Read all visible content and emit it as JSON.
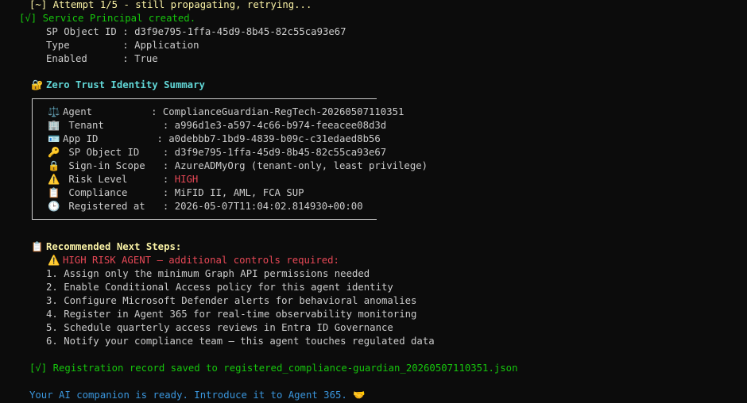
{
  "attempt": "[~] Attempt 1/5 - still propagating, retrying...",
  "sp_created": "[√] Service Principal created.",
  "sp_details": [
    {
      "label": "SP Object ID",
      "value": "d3f9e795-1ffa-45d9-8b45-82c55ca93e67"
    },
    {
      "label": "Type",
      "value": "Application"
    },
    {
      "label": "Enabled",
      "value": "True"
    }
  ],
  "summary": {
    "icon": "🔐",
    "title": "Zero Trust Identity Summary",
    "rows": [
      {
        "icon": "⚖️",
        "label": "Agent",
        "value": "ComplianceGuardian-RegTech-20260507110351"
      },
      {
        "icon": "🏢",
        "label": "Tenant",
        "value": "a996d1e3-a597-4c66-b974-feeacee08d3d"
      },
      {
        "icon": "🪪",
        "label": "App ID",
        "value": "a0debbb7-1bd9-4839-b09c-c31edaed8b56"
      },
      {
        "icon": "🔑",
        "label": "SP Object ID",
        "value": "d3f9e795-1ffa-45d9-8b45-82c55ca93e67"
      },
      {
        "icon": "🔒",
        "label": "Sign-in Scope",
        "value": "AzureADMyOrg (tenant-only, least privilege)"
      },
      {
        "icon": "⚠️",
        "label": "Risk Level",
        "value": "HIGH"
      },
      {
        "icon": "📋",
        "label": "Compliance",
        "value": "MiFID II, AML, FCA SUP"
      },
      {
        "icon": "🕒",
        "label": "Registered at",
        "value": "2026-05-07T11:04:02.814930+00:00"
      }
    ]
  },
  "next_steps": {
    "icon": "📋",
    "title": "Recommended Next Steps:",
    "warning_icon": "⚠️",
    "warning": "HIGH RISK AGENT — additional controls required:",
    "items": [
      "1. Assign only the minimum Graph API permissions needed",
      "2. Enable Conditional Access policy for this agent identity",
      "3. Configure Microsoft Defender alerts for behavioral anomalies",
      "4. Register in Agent 365 for real-time observability monitoring",
      "5. Schedule quarterly access reviews in Entra ID Governance",
      "6. Notify your compliance team — this agent touches regulated data"
    ]
  },
  "record_saved": "[√] Registration record saved to registered_compliance-guardian_20260507110351.json",
  "closing": "Your AI companion is ready. Introduce it to Agent 365.",
  "closing_icon": "🤝",
  "colors": {
    "background": "#0c0c0c",
    "text": "#cccccc",
    "success": "#16c60c",
    "warning_yellow": "#f9f1a5",
    "heading_cyan": "#61d6d6",
    "closing_blue": "#3a96dd",
    "risk_red": "#e74856"
  }
}
